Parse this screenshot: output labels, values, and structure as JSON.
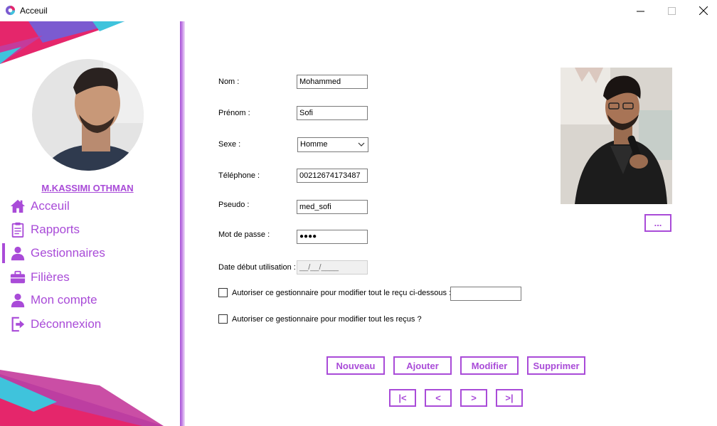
{
  "window": {
    "title": "Acceuil"
  },
  "sidebar": {
    "user_name": "M.KASSIMI OTHMAN",
    "items": [
      {
        "label": "Acceuil",
        "icon": "home-icon"
      },
      {
        "label": "Rapports",
        "icon": "clipboard-icon"
      },
      {
        "label": "Gestionnaires",
        "icon": "user-icon",
        "active": true
      },
      {
        "label": "Filières",
        "icon": "briefcase-icon"
      },
      {
        "label": "Mon compte",
        "icon": "user-icon"
      },
      {
        "label": "Déconnexion",
        "icon": "logout-icon"
      }
    ]
  },
  "form": {
    "nom_label": "Nom :",
    "nom_value": "Mohammed",
    "prenom_label": "Prénom :",
    "prenom_value": "Sofi",
    "sexe_label": "Sexe :",
    "sexe_value": "Homme",
    "telephone_label": "Téléphone :",
    "telephone_value": "00212674173487",
    "pseudo_label": "Pseudo :",
    "pseudo_value": "med_sofi",
    "password_label": "Mot de passe :",
    "password_value": "●●●●",
    "date_label": "Date début utilisation :",
    "date_value": "__/__/____",
    "check1_label": "Autoriser ce gestionnaire pour modifier tout le reçu ci-dessous :",
    "check1_value": "",
    "check2_label": "Autoriser  ce gestionnaire pour modifier tout les reçus ?"
  },
  "photo_browse_label": "...",
  "actions": {
    "nouveau": "Nouveau",
    "ajouter": "Ajouter",
    "modifier": "Modifier",
    "supprimer": "Supprimer"
  },
  "navigation": {
    "first": "|<",
    "prev": "<",
    "next": ">",
    "last": ">|"
  },
  "colors": {
    "accent": "#a94bd8",
    "pink": "#e5266b",
    "cyan": "#3fc3dc",
    "violet": "#7b5bd0"
  }
}
